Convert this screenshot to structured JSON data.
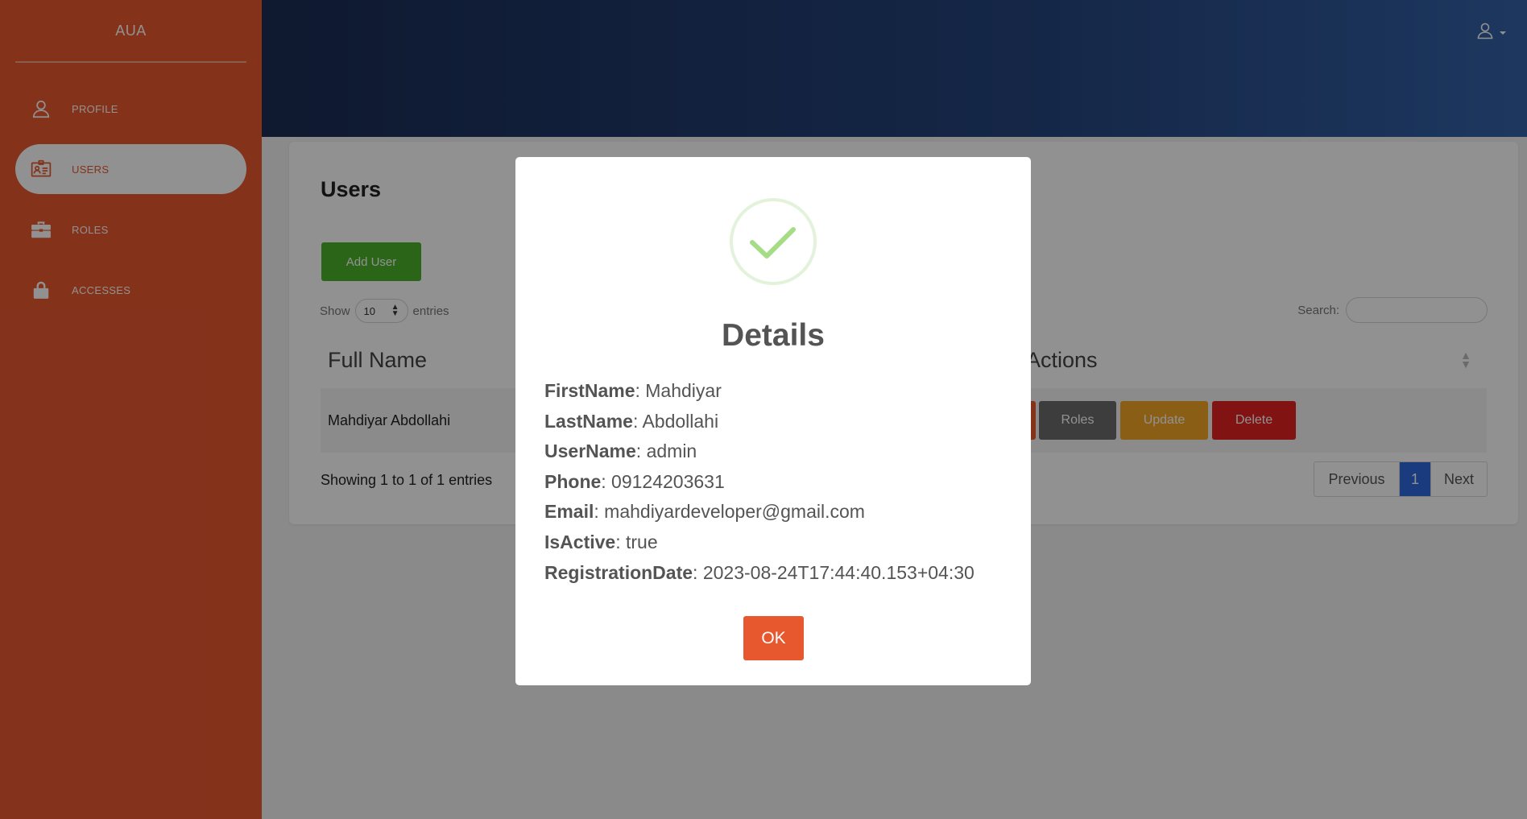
{
  "sidebar": {
    "brand": "AUA",
    "items": [
      {
        "label": "PROFILE",
        "icon": "user-icon"
      },
      {
        "label": "USERS",
        "icon": "id-card-icon",
        "active": true
      },
      {
        "label": "ROLES",
        "icon": "briefcase-icon"
      },
      {
        "label": "ACCESSES",
        "icon": "lock-icon"
      }
    ]
  },
  "header": {
    "user_icon": "user-icon"
  },
  "card": {
    "title": "Users",
    "add_user_label": "Add User",
    "show_label": "Show",
    "page_size": "10",
    "entries_label": "entries",
    "search_label": "Search:",
    "columns": [
      "Full Name",
      "Actions"
    ],
    "rows": [
      {
        "full_name": "Mahdiyar Abdollahi"
      }
    ],
    "action_buttons": {
      "roles": "Roles",
      "update": "Update",
      "delete": "Delete"
    },
    "showing_text": "Showing 1 to 1 of 1 entries",
    "pager": {
      "previous": "Previous",
      "current": "1",
      "next": "Next"
    }
  },
  "modal": {
    "icon": "success-check-icon",
    "title": "Details",
    "fields": [
      {
        "key": "FirstName",
        "value": ": Mahdiyar"
      },
      {
        "key": "LastName",
        "value": ": Abdollahi"
      },
      {
        "key": "UserName",
        "value": ": admin"
      },
      {
        "key": "Phone",
        "value": ": 09124203631"
      },
      {
        "key": "Email",
        "value": ": mahdiyardeveloper@gmail.com"
      },
      {
        "key": "IsActive",
        "value": ": true"
      },
      {
        "key": "RegistrationDate",
        "value": ": 2023-08-24T17:44:40.153+04:30"
      }
    ],
    "ok_label": "OK"
  },
  "colors": {
    "sidebar": "#e8582f",
    "header_dark": "#1b2d55",
    "header_light": "#3462a8",
    "add_user": "#4cb32b",
    "roles": "#6b6b6b",
    "update": "#f3a826",
    "delete": "#e52222",
    "pager_active": "#2f68de",
    "success": "#a5dc86"
  }
}
